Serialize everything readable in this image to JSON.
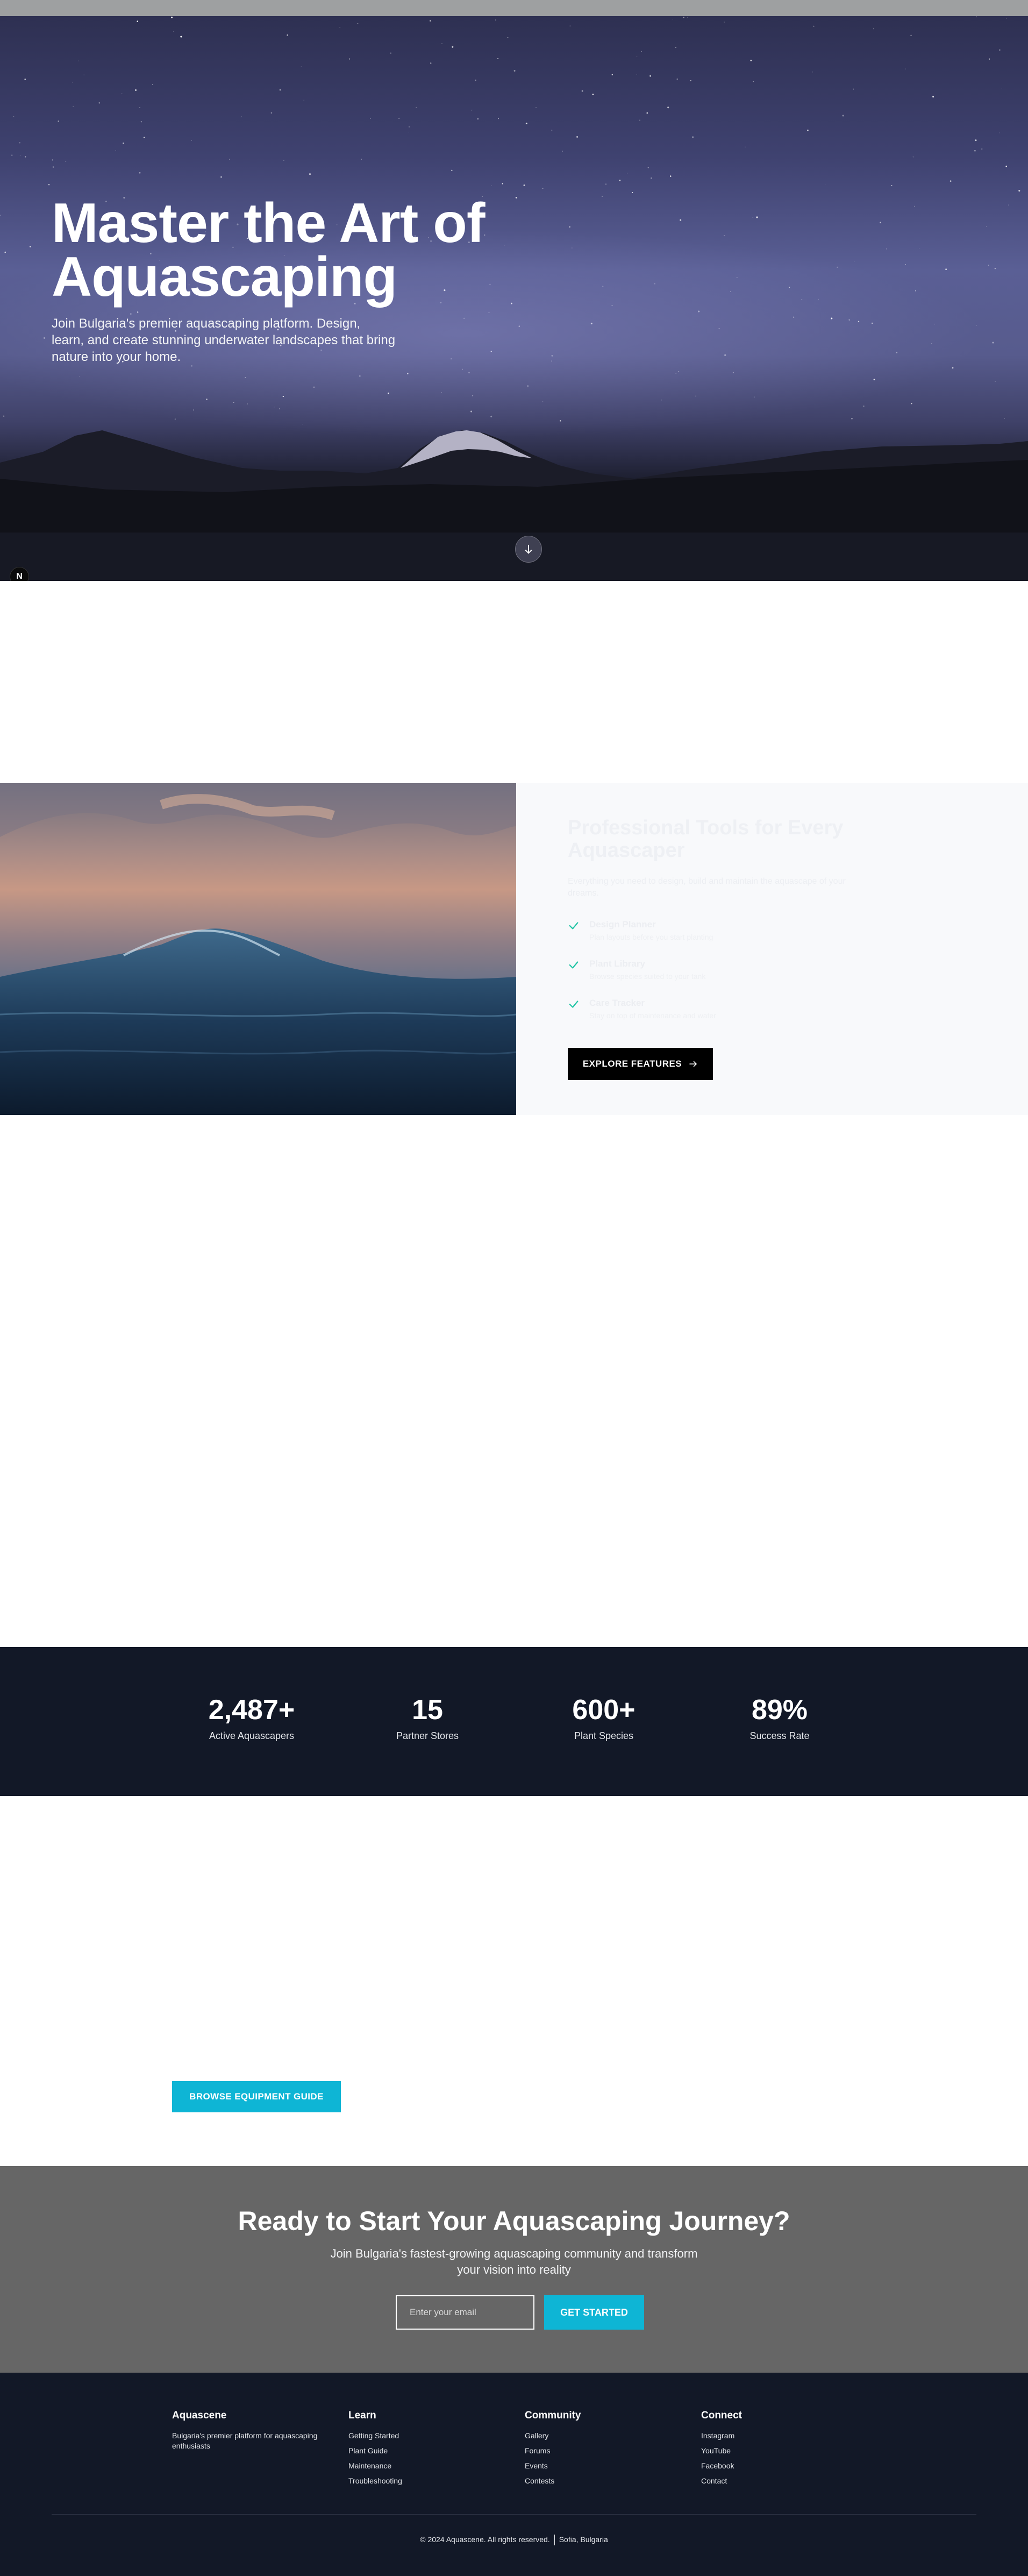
{
  "hero": {
    "title_line1": "Master the Art of",
    "title_line2": "Aquascaping",
    "subtitle": "Join Bulgaria's premier aquascaping platform. Design, learn, and create stunning underwater landscapes that bring nature into your home.",
    "badge_letter": "N"
  },
  "feature": {
    "title": "Professional Tools for Every Aquascaper",
    "description": "Everything you need to design, build and maintain the aquascape of your dreams.",
    "items": [
      {
        "label": "Design Planner",
        "sub": "Plan layouts before you start planting"
      },
      {
        "label": "Plant Library",
        "sub": "Browse species suited to your tank"
      },
      {
        "label": "Care Tracker",
        "sub": "Stay on top of maintenance and water"
      }
    ],
    "button_label": "EXPLORE FEATURES"
  },
  "stats": [
    {
      "value": "2,487+",
      "label": "Active Aquascapers"
    },
    {
      "value": "15",
      "label": "Partner Stores"
    },
    {
      "value": "600+",
      "label": "Plant Species"
    },
    {
      "value": "89%",
      "label": "Success Rate"
    }
  ],
  "equipment": {
    "button_label": "BROWSE EQUIPMENT GUIDE"
  },
  "cta": {
    "title": "Ready to Start Your Aquascaping Journey?",
    "subtitle": "Join Bulgaria's fastest-growing aquascaping community and transform your vision into reality",
    "email_placeholder": "Enter your email",
    "button_label": "GET STARTED"
  },
  "footer": {
    "brand": {
      "title": "Aquascene",
      "description": "Bulgaria's premier platform for aquascaping enthusiasts"
    },
    "columns": [
      {
        "title": "Learn",
        "links": [
          "Getting Started",
          "Plant Guide",
          "Maintenance",
          "Troubleshooting"
        ]
      },
      {
        "title": "Community",
        "links": [
          "Gallery",
          "Forums",
          "Events",
          "Contests"
        ]
      },
      {
        "title": "Connect",
        "links": [
          "Instagram",
          "YouTube",
          "Facebook",
          "Contact"
        ]
      }
    ],
    "copyright": "© 2024 Aquascene. All rights reserved.",
    "location": "Sofia, Bulgaria"
  },
  "colors": {
    "accent": "#0eb5d5",
    "dark_navy": "#121827",
    "cta_gray": "#666666",
    "check_green": "#22c5a5"
  },
  "icons": {
    "scroll": "arrow-down-icon",
    "check": "check-icon",
    "explore": "arrow-right-icon"
  }
}
